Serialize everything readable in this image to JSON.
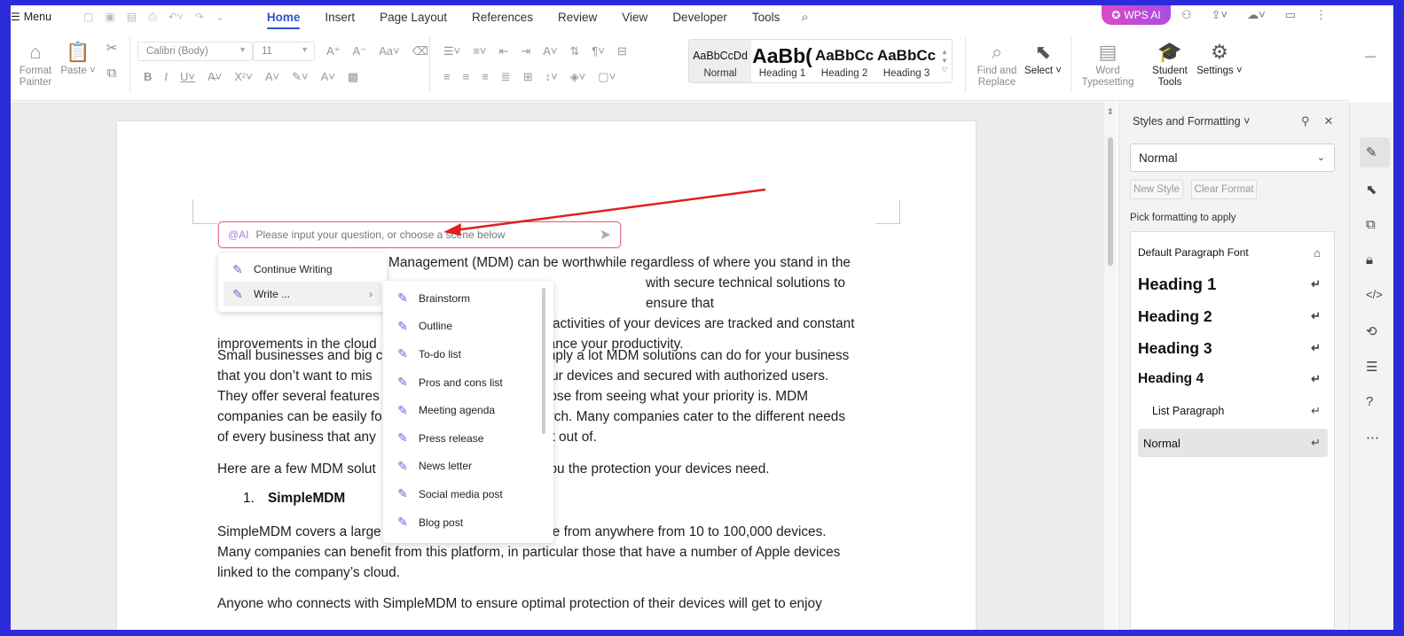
{
  "topbar": {
    "menu_label": "Menu",
    "tabs": [
      "Home",
      "Insert",
      "Page Layout",
      "References",
      "Review",
      "View",
      "Developer",
      "Tools"
    ],
    "wps_ai_label": "WPS AI"
  },
  "ribbon": {
    "format_painter": "Format Painter",
    "paste": "Paste",
    "font_name": "Calibri (Body)",
    "font_size": "11",
    "styles": [
      {
        "preview": "AaBbCcDd",
        "label": "Normal"
      },
      {
        "preview": "AaBb(",
        "label": "Heading 1"
      },
      {
        "preview": "AaBbCc",
        "label": "Heading 2"
      },
      {
        "preview": "AaBbCc",
        "label": "Heading 3"
      }
    ],
    "find_replace": "Find and Replace",
    "select": "Select",
    "word_typesetting": "Word Typesetting",
    "student_tools": "Student Tools",
    "settings": "Settings"
  },
  "document": {
    "ai_tag": "@AI",
    "ai_placeholder": "Please input your question, or choose a scene below",
    "p1_line1": "Management (MDM) can be worthwhile regardless of where you stand in the",
    "p1_line2": "with secure technical solutions to ensure that",
    "p1_line3": "activities of your devices are tracked and constant",
    "p1_line4a": "improvements in the cloud",
    "p1_line4b": "ance your productivity.",
    "p2_line1a": "Small businesses and big c",
    "p2_line1b": "mply a lot MDM solutions can do for your business",
    "p2_line2a": "that you don’t want to mis",
    "p2_line2b": "our devices and secured with authorized users.",
    "p2_line3a": "They offer several features",
    "p2_line3b": "oose from seeing what your priority is. MDM",
    "p2_line4a": "companies can be easily fo",
    "p2_line4b": "rch. Many companies cater to the different needs",
    "p2_line5a": "of every business that any",
    "p2_line5b": "st out of.",
    "p3a": "Here are a few MDM solut",
    "p3b": "you the protection your devices need.",
    "list_num": "1.",
    "list_heading": "SimpleMDM",
    "p4_line1a": "SimpleMDM covers a large",
    "p4_line1b": "e from anywhere from 10 to 100,000 devices.",
    "p4_line2": "Many companies can benefit from this platform, in particular those that have a number of Apple devices",
    "p4_line3": "linked to the company’s cloud.",
    "p5_line1": "Anyone who connects with SimpleMDM to ensure optimal protection of their devices will get to enjoy"
  },
  "ai_menu": {
    "items": [
      "Continue Writing",
      "Write ..."
    ],
    "submenu": [
      "Brainstorm",
      "Outline",
      "To-do list",
      "Pros and cons list",
      "Meeting agenda",
      "Press release",
      "News letter",
      "Social media post",
      "Blog post"
    ]
  },
  "panel": {
    "title": "Styles and Formatting",
    "current_style": "Normal",
    "new_style": "New Style",
    "clear_format": "Clear Format",
    "pick_label": "Pick formatting to apply",
    "styles": [
      "Default Paragraph Font",
      "Heading 1",
      "Heading 2",
      "Heading 3",
      "Heading 4",
      "List Paragraph",
      "Normal"
    ]
  },
  "colors": {
    "accent": "#2a56c6",
    "ai_gradient_start": "#d94cc4",
    "ai_gradient_end": "#a94de2",
    "arrow": "#e02020"
  }
}
